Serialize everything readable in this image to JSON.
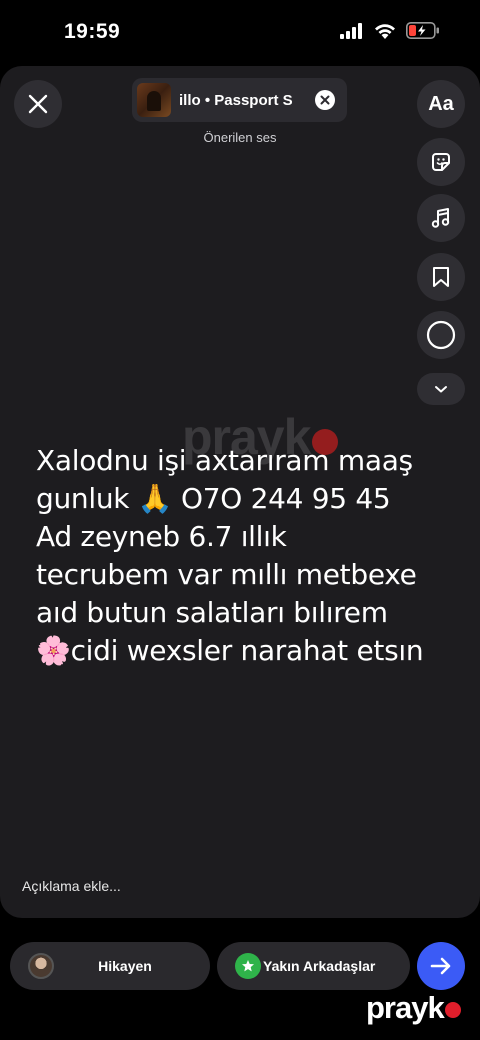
{
  "status_bar": {
    "time": "19:59"
  },
  "music": {
    "title": "illo • Passport  S",
    "suggested_label": "Önerilen ses"
  },
  "tools": {
    "text_label": "Aa"
  },
  "story": {
    "lines": [
      "Xalodnu işi axtarıram maaş",
      "gunluk  🙏 O7O 244 95 45",
      "Ad zeyneb  6.7 ıllık",
      "tecrubem var mıllı metbexe",
      "aıd butun salatları bılırem",
      "🌸cidi wexsler narahat etsın"
    ]
  },
  "caption": {
    "placeholder": "Açıklama ekle..."
  },
  "share": {
    "story_label": "Hikayen",
    "close_friends_label": "Yakın Arkadaşlar"
  },
  "watermark": {
    "text": "prayk"
  },
  "brand": {
    "text": "prayk"
  },
  "colors": {
    "accent": "#3b5bf6",
    "close_friends": "#2fb34a",
    "brand_dot": "#e01e2b"
  }
}
